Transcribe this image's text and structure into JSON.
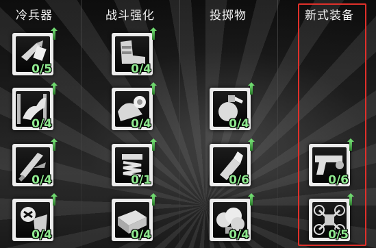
{
  "columns": [
    {
      "header": "冷兵器",
      "slots": [
        {
          "icon": "combat-knife-icon",
          "count": "0/5"
        },
        {
          "icon": "kick-icon",
          "count": "0/4"
        },
        {
          "icon": "machete-icon",
          "count": "0/4"
        },
        {
          "icon": "takedown-icon",
          "count": "0/4"
        }
      ]
    },
    {
      "header": "战斗强化",
      "slots": [
        {
          "icon": "armored-boot-icon",
          "count": "0/4"
        },
        {
          "icon": "bandage-icon",
          "count": "0/4"
        },
        {
          "icon": "spring-icon",
          "count": "0/1"
        },
        {
          "icon": "ammo-crate-icon",
          "count": "0/4"
        }
      ]
    },
    {
      "header": "投掷物",
      "slots": [
        {
          "icon": "grenade-icon",
          "count": "0/4"
        },
        {
          "icon": "molotov-icon",
          "count": "0/6"
        },
        {
          "icon": "smoke-cloud-icon",
          "count": "0/4"
        }
      ]
    },
    {
      "header": "新式装备",
      "slots": [
        {
          "icon": "pistol-icon",
          "count": "0/6"
        },
        {
          "icon": "drone-icon",
          "count": "0/5"
        }
      ]
    }
  ],
  "colors": {
    "count_text": "#8fe98f",
    "highlight_border": "#e0302a",
    "header_text": "#f2f2f2"
  }
}
